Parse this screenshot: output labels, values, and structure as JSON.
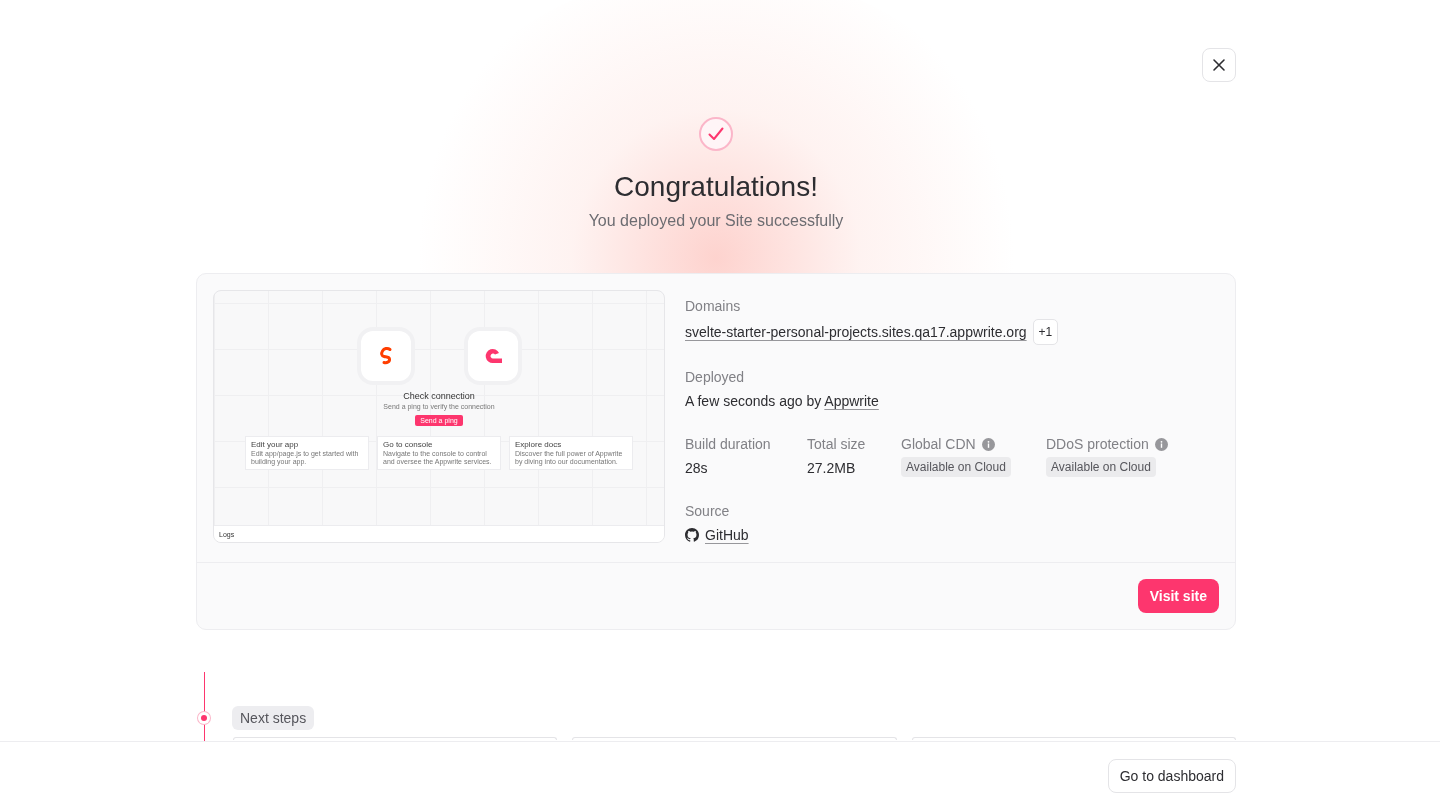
{
  "header": {
    "title": "Congratulations!",
    "subtitle": "You deployed your Site successfully"
  },
  "preview": {
    "title": "Check connection",
    "subtitle": "Send a ping to verify the connection",
    "button": "Send a ping",
    "cards": [
      {
        "title": "Edit your app",
        "text": "Edit app/page.js to get started with building your app."
      },
      {
        "title": "Go to console",
        "text": "Navigate to the console to control and oversee the Appwrite services."
      },
      {
        "title": "Explore docs",
        "text": "Discover the full power of Appwrite by diving into our documentation."
      }
    ],
    "footer": "Logs"
  },
  "domains": {
    "label": "Domains",
    "value": "svelte-starter-personal-projects.sites.qa17.appwrite.org",
    "extra": "+1"
  },
  "deployed": {
    "label": "Deployed",
    "text": "A few seconds ago by",
    "author": "Appwrite"
  },
  "stats": [
    {
      "label": "Build duration",
      "value": "28s",
      "kind": "text",
      "info": false
    },
    {
      "label": "Total size",
      "value": "27.2MB",
      "kind": "text",
      "info": false
    },
    {
      "label": "Global CDN",
      "value": "Available on Cloud",
      "kind": "badge",
      "info": true
    },
    {
      "label": "DDoS protection",
      "value": "Available on Cloud",
      "kind": "badge",
      "info": true
    }
  ],
  "source": {
    "label": "Source",
    "value": "GitHub"
  },
  "visit_button": "Visit site",
  "next_steps": {
    "label": "Next steps"
  },
  "footer_button": "Go to dashboard"
}
